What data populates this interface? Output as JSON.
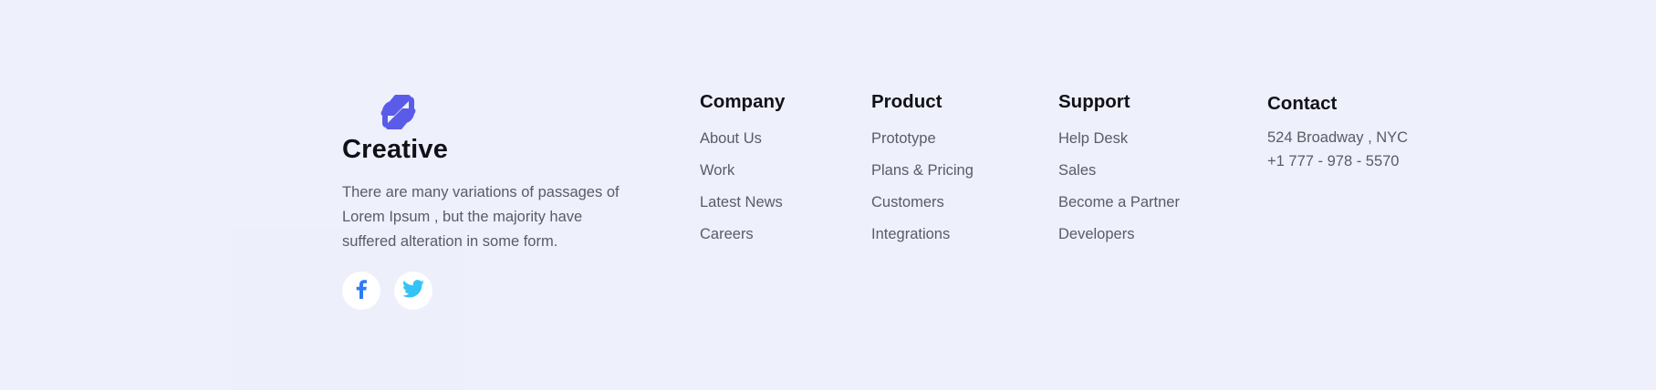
{
  "brand": {
    "name": "Creative",
    "description": "There are many variations of passages of Lorem Ipsum , but the majority have suffered alteration in some form.",
    "logo_icon": "brand-logo-icon",
    "logo_color": "#5b5bea"
  },
  "social": [
    {
      "icon": "facebook-icon",
      "color": "#2f7bf5"
    },
    {
      "icon": "twitter-icon",
      "color": "#34c3f5"
    }
  ],
  "columns": {
    "company": {
      "title": "Company",
      "links": [
        "About Us",
        "Work",
        "Latest News",
        "Careers"
      ]
    },
    "product": {
      "title": "Product",
      "links": [
        "Prototype",
        "Plans & Pricing",
        "Customers",
        "Integrations"
      ]
    },
    "support": {
      "title": "Support",
      "links": [
        "Help Desk",
        "Sales",
        "Become a Partner",
        "Developers"
      ]
    }
  },
  "contact": {
    "title": "Contact",
    "address": "524 Broadway , NYC",
    "phone": "+1 777 - 978 - 5570"
  },
  "colors": {
    "background": "#eef0fc",
    "heading": "#111118",
    "text": "#5b5b66"
  }
}
